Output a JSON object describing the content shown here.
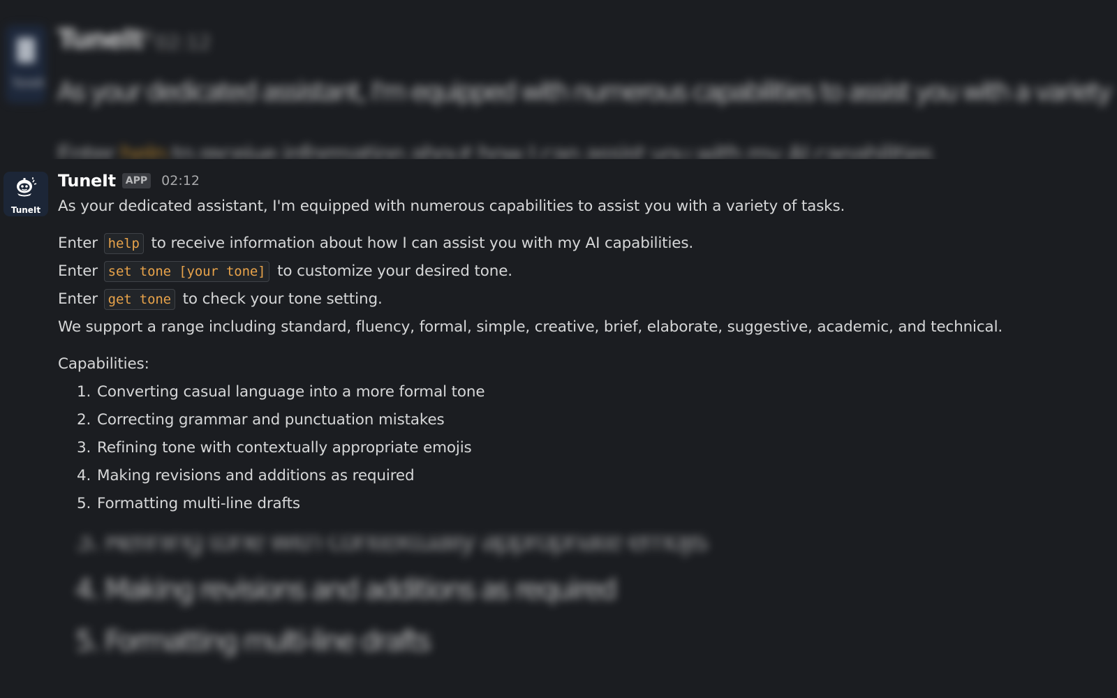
{
  "message": {
    "app_name": "TuneIt",
    "badge": "APP",
    "time": "02:12",
    "avatar_label": "TuneIt",
    "intro": "As your dedicated assistant, I'm equipped with numerous capabilities to assist you with a variety of tasks.",
    "commands": [
      {
        "prefix": "Enter",
        "code": "help",
        "suffix": "to receive information about how I can assist you with my AI capabilities."
      },
      {
        "prefix": "Enter",
        "code": "set tone [your tone]",
        "suffix": "to customize your desired tone."
      },
      {
        "prefix": "Enter",
        "code": "get tone",
        "suffix": "to check your tone setting."
      }
    ],
    "range_text": "We support a range including standard, fluency, formal, simple, creative, brief, elaborate, suggestive, academic, and technical.",
    "capabilities_heading": "Capabilities:",
    "capabilities": [
      {
        "num": "1.",
        "text": "Converting casual language into a more formal tone"
      },
      {
        "num": "2.",
        "text": "Correcting grammar and punctuation mistakes"
      },
      {
        "num": "3.",
        "text": "Refining tone with contextually appropriate emojis"
      },
      {
        "num": "4.",
        "text": "Making revisions and additions as required"
      },
      {
        "num": "5.",
        "text": "Formatting multi-line drafts"
      }
    ]
  },
  "colors": {
    "background": "#1b1d21",
    "code_text": "#e8a34a",
    "text": "#d6d7d8",
    "avatar_bg": "#1c2637"
  },
  "icons": {
    "avatar": "tuneit-robot-icon"
  }
}
